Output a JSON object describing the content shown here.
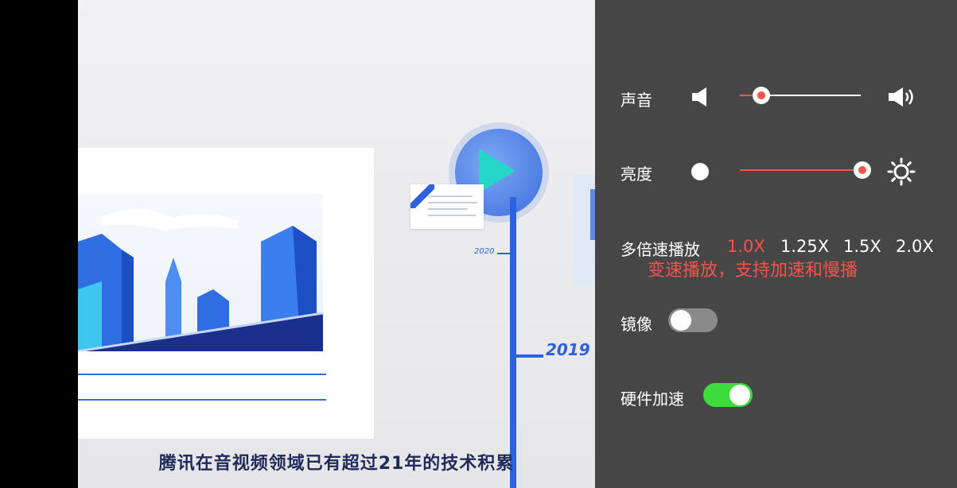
{
  "video": {
    "subtitle": "腾讯在音视频领域已有超过21年的技术积累",
    "year_2020": "2020",
    "year_2019": "2019"
  },
  "settings": {
    "volume": {
      "label": "声音",
      "level": 0.18,
      "min_icon": "speaker-low-icon",
      "max_icon": "speaker-high-icon"
    },
    "brightness": {
      "label": "亮度",
      "level": 1.0,
      "min_icon": "brightness-low-icon",
      "max_icon": "sun-icon"
    },
    "speed": {
      "label": "多倍速播放",
      "options": [
        "1.0X",
        "1.25X",
        "1.5X",
        "2.0X"
      ],
      "selected": "1.0X",
      "hint": "变速播放，支持加速和慢播"
    },
    "mirror": {
      "label": "镜像",
      "on": false
    },
    "hw_accel": {
      "label": "硬件加速",
      "on": true
    }
  },
  "colors": {
    "panel_bg": "#464646",
    "accent": "#f4544a",
    "toggle_on": "#3ddc3d",
    "toggle_off": "#8a8a8a",
    "timeline_blue": "#2c62e0"
  }
}
